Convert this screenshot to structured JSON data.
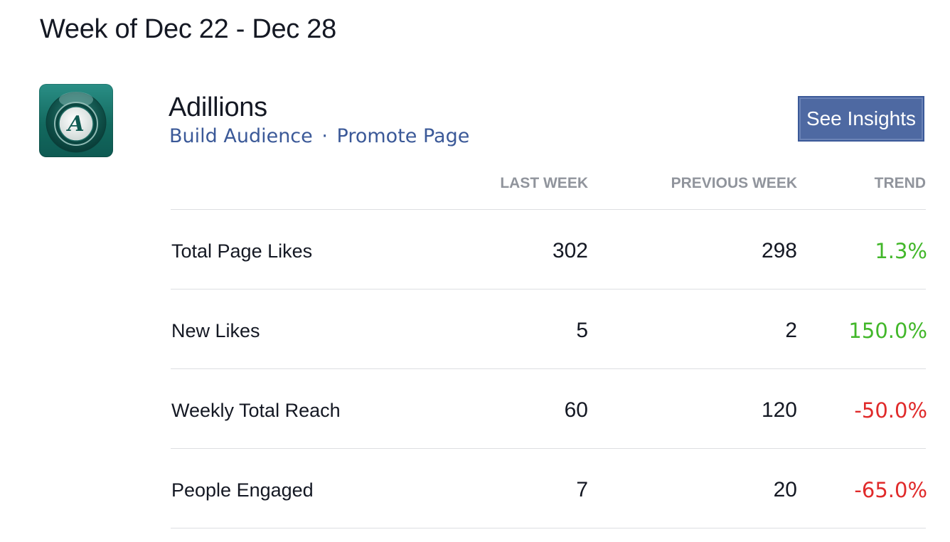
{
  "header": {
    "week_title": "Week of Dec 22 - Dec 28"
  },
  "page": {
    "name": "Adillions",
    "logo_icon": "adillions-logo-icon",
    "links": [
      {
        "label": "Build Audience"
      },
      {
        "label": "Promote Page"
      }
    ],
    "link_separator": "·",
    "insights_button": "See Insights"
  },
  "table": {
    "columns": [
      "LAST WEEK",
      "PREVIOUS WEEK",
      "TREND"
    ],
    "rows": [
      {
        "label": "Total Page Likes",
        "last_week": "302",
        "previous_week": "298",
        "trend": "1.3%",
        "trend_color": "#42b72a"
      },
      {
        "label": "New Likes",
        "last_week": "5",
        "previous_week": "2",
        "trend": "150.0%",
        "trend_color": "#42b72a"
      },
      {
        "label": "Weekly Total Reach",
        "last_week": "60",
        "previous_week": "120",
        "trend": "-50.0%",
        "trend_color": "#e02a2a"
      },
      {
        "label": "People Engaged",
        "last_week": "7",
        "previous_week": "20",
        "trend": "-65.0%",
        "trend_color": "#e02a2a"
      }
    ]
  },
  "colors": {
    "link": "#3b5998",
    "button": "#4e69a2",
    "positive": "#42b72a",
    "negative": "#e02a2a",
    "header_gray": "#90949c"
  }
}
